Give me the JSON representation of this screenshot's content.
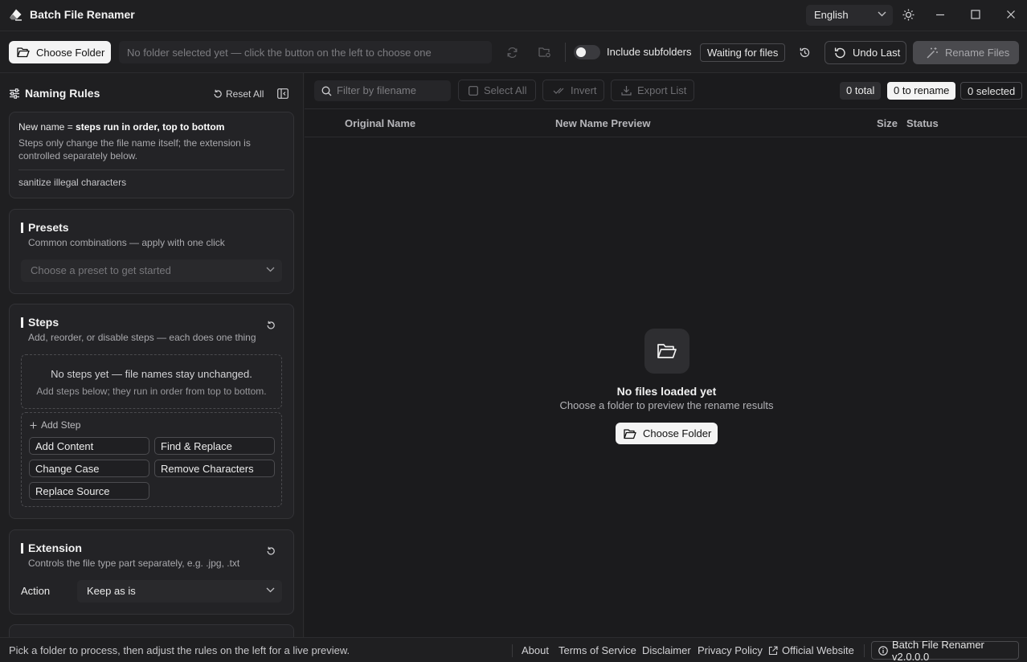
{
  "app": {
    "title": "Batch File Renamer",
    "language": "English"
  },
  "toolbar": {
    "choose_folder_label": "Choose Folder",
    "path_placeholder": "No folder selected yet — click the button on the left to choose one",
    "include_subfolders_label": "Include subfolders",
    "include_subfolders_on": false,
    "status_badge": "Waiting for files",
    "undo_label": "Undo Last",
    "rename_label": "Rename Files"
  },
  "sidebar": {
    "title": "Naming Rules",
    "reset_all_label": "Reset All",
    "summary": {
      "prefix": "New name = ",
      "emphasis": "steps run in order, top to bottom",
      "description": "Steps only change the file name itself; the extension is controlled separately below.",
      "note": "sanitize illegal characters"
    },
    "presets": {
      "title": "Presets",
      "subtitle": "Common combinations — apply with one click",
      "placeholder": "Choose a preset to get started"
    },
    "steps": {
      "title": "Steps",
      "subtitle": "Add, reorder, or disable steps — each does one thing",
      "empty_title": "No steps yet — file names stay unchanged.",
      "empty_sub": "Add steps below; they run in order from top to bottom.",
      "add_step_label": "Add Step",
      "buttons": [
        "Add Content",
        "Find & Replace",
        "Change Case",
        "Remove Characters",
        "Replace Source"
      ]
    },
    "extension": {
      "title": "Extension",
      "subtitle": "Controls the file type part separately, e.g. .jpg, .txt",
      "action_label": "Action",
      "action_value": "Keep as is"
    }
  },
  "main": {
    "filter_placeholder": "Filter by filename",
    "select_all_label": "Select All",
    "invert_label": "Invert",
    "export_label": "Export List",
    "counts": {
      "total": "0 total",
      "to_rename": "0 to rename",
      "selected": "0 selected"
    },
    "columns": [
      "Original Name",
      "New Name Preview",
      "Size",
      "Status"
    ],
    "empty_title": "No files loaded yet",
    "empty_sub": "Choose a folder to preview the rename results",
    "empty_button": "Choose Folder"
  },
  "statusbar": {
    "text": "Pick a folder to process, then adjust the rules on the left for a live preview.",
    "links": [
      "About",
      "Terms of Service",
      "Disclaimer",
      "Privacy Policy",
      "Official Website"
    ],
    "version": "Batch File Renamer v2.0.0.0"
  }
}
